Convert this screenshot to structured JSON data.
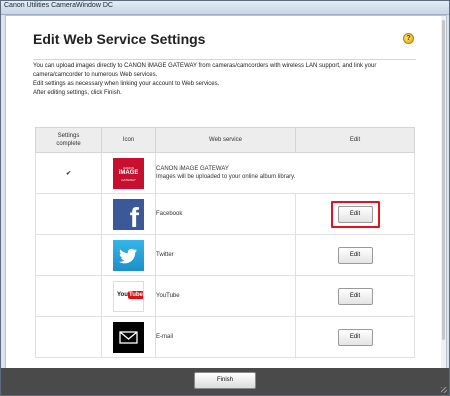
{
  "window": {
    "title": "Canon Utilities CameraWindow DC"
  },
  "page": {
    "heading": "Edit Web Service Settings",
    "help_icon": "?",
    "intro": [
      "You can upload images directly to CANON iMAGE GATEWAY from cameras/camcorders with wireless LAN support, and link your",
      "camera/camcorder to numerous Web services.",
      "Edit settings as necessary when linking your account to Web services.",
      "After editing settings, click Finish."
    ]
  },
  "table": {
    "headers": {
      "settings_line1": "Settings",
      "settings_line2": "complete",
      "icon": "Icon",
      "web_service": "Web service",
      "edit": "Edit"
    },
    "rows": [
      {
        "complete": true,
        "check_mark": "✔",
        "icon": "canon-image-gateway-icon",
        "icon_text": [
          "CANON",
          "iMAGE",
          "GATEWAY"
        ],
        "service": "CANON iMAGE GATEWAY",
        "description": "Images will be uploaded to your online album library."
      },
      {
        "icon": "facebook-icon",
        "icon_glyph": "f",
        "service": "Facebook",
        "edit_label": "Edit",
        "highlighted": true
      },
      {
        "icon": "twitter-icon",
        "service": "Twitter",
        "edit_label": "Edit"
      },
      {
        "icon": "youtube-icon",
        "icon_text": [
          "You",
          "Tube"
        ],
        "service": "YouTube",
        "edit_label": "Edit"
      },
      {
        "icon": "email-icon",
        "service": "E-mail",
        "edit_label": "Edit"
      }
    ]
  },
  "footer": {
    "finish_label": "Finish"
  },
  "colors": {
    "highlight_border": "#e0141a",
    "canon_red": "#c8102e",
    "facebook_blue": "#3b5998",
    "twitter_blue": "#1d8fcc",
    "check_green": "#3aa81f",
    "footer_bg": "#4a4a4a"
  }
}
